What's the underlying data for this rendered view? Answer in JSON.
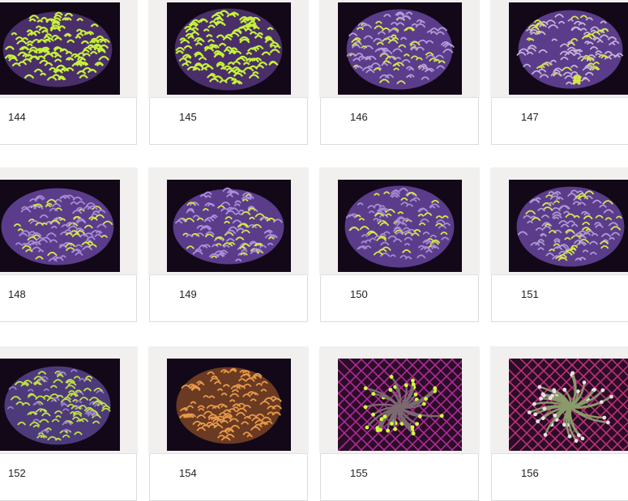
{
  "gallery": {
    "items": [
      {
        "number": "144",
        "color": "#c6f23a",
        "style": "loops-green"
      },
      {
        "number": "145",
        "color": "#c6f23a",
        "style": "loops-green"
      },
      {
        "number": "146",
        "color": "#b49ad8",
        "style": "purple-yellow"
      },
      {
        "number": "147",
        "color": "#c8b0d8",
        "style": "purple-yellow"
      },
      {
        "number": "148",
        "color": "#a98bd6",
        "style": "purple-yellow"
      },
      {
        "number": "149",
        "color": "#ad8fdc",
        "style": "purple-yellow"
      },
      {
        "number": "150",
        "color": "#a68ad2",
        "style": "purple-yellow"
      },
      {
        "number": "151",
        "color": "#b098d4",
        "style": "purple-yellow"
      },
      {
        "number": "152",
        "color": "#c0e04a",
        "style": "green-purple"
      },
      {
        "number": "154",
        "color": "#e89a4a",
        "style": "orange-loops"
      },
      {
        "number": "155",
        "color": "#d6ff3a",
        "style": "torch-purple"
      },
      {
        "number": "156",
        "color": "#e8e0e8",
        "style": "torch-pink"
      }
    ]
  }
}
